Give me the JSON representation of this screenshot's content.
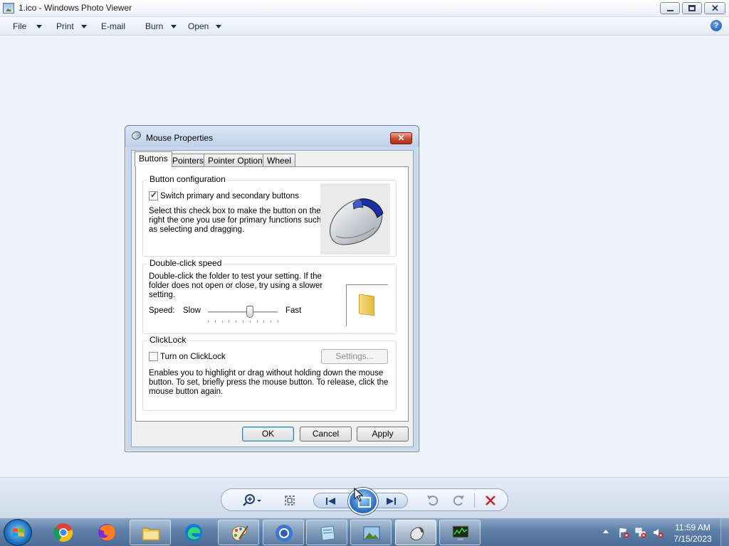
{
  "viewer": {
    "title": "1.ico - Windows Photo Viewer",
    "menu": [
      {
        "label": "File",
        "has_arrow": true
      },
      {
        "label": "Print",
        "has_arrow": true
      },
      {
        "label": "E-mail",
        "has_arrow": false
      },
      {
        "label": "Burn",
        "has_arrow": true
      },
      {
        "label": "Open",
        "has_arrow": true
      }
    ],
    "help_label": "?",
    "window_controls": [
      "minimize-icon",
      "restore-icon",
      "close-icon"
    ]
  },
  "photo": {
    "dialog_title": "Mouse Properties",
    "close_label": "✕",
    "tabs": [
      "Buttons",
      "Pointers",
      "Pointer Options",
      "Wheel"
    ],
    "active_tab": "Buttons",
    "button_config": {
      "legend": "Button configuration",
      "checkbox_label": "Switch primary and secondary buttons",
      "checked": true,
      "description": [
        "Select this check box to make the button on the",
        "right the one you use for primary functions such",
        "as selecting and dragging."
      ]
    },
    "double_click": {
      "legend": "Double-click speed",
      "description": [
        "Double-click the folder to test your setting. If the",
        "folder does not open or close, try using a slower",
        "setting."
      ],
      "speed_label": "Speed:",
      "slow_label": "Slow",
      "fast_label": "Fast",
      "slider_level": 0.6
    },
    "clicklock": {
      "legend": "ClickLock",
      "checkbox_label": "Turn on ClickLock",
      "checked": false,
      "settings_label": "Settings...",
      "description": [
        "Enables you to highlight or drag without holding down the mouse",
        "button. To set, briefly press the mouse button. To release, click the",
        "mouse button again."
      ]
    },
    "buttons": {
      "ok": "OK",
      "cancel": "Cancel",
      "apply": "Apply"
    }
  },
  "controls": {
    "items": [
      "zoom-icon",
      "actual-size-icon",
      "previous-icon",
      "slideshow-icon",
      "next-icon",
      "rotate-counterclockwise-icon",
      "rotate-clockwise-icon",
      "delete-icon"
    ]
  },
  "taskbar": {
    "apps": [
      {
        "name": "chrome",
        "state": "pinned"
      },
      {
        "name": "firefox",
        "state": "pinned"
      },
      {
        "name": "file-explorer",
        "state": "open"
      },
      {
        "name": "edge",
        "state": "pinned"
      },
      {
        "name": "paint",
        "state": "open"
      },
      {
        "name": "chrome-2",
        "state": "open"
      },
      {
        "name": "notepad",
        "state": "open"
      },
      {
        "name": "photo-viewer",
        "state": "open"
      },
      {
        "name": "mouse-properties",
        "state": "active"
      },
      {
        "name": "task-manager",
        "state": "open"
      }
    ],
    "clock_time": "11:59 AM",
    "clock_date": "7/15/2023"
  },
  "colors": {
    "accent": "#1d3f78",
    "delete_red": "#c8202a",
    "taskbar": "#5d7fa8"
  }
}
